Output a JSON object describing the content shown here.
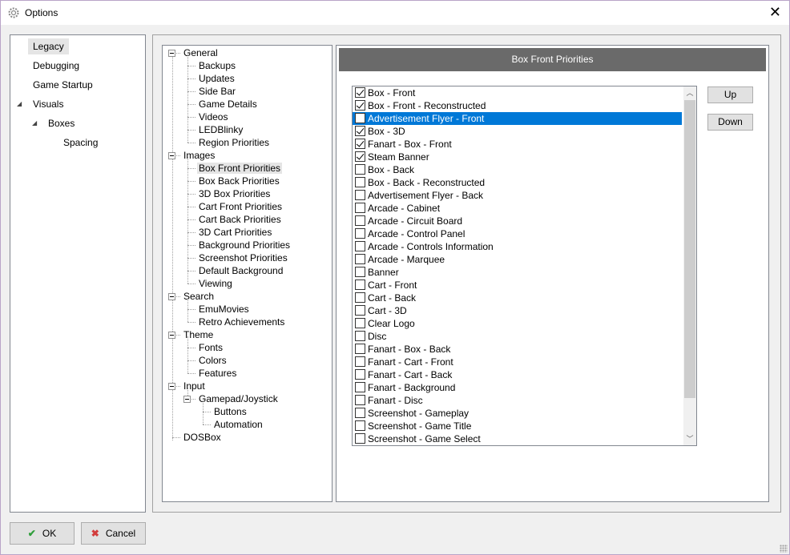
{
  "window": {
    "title": "Options",
    "close_glyph": "✕",
    "icon": "gear-icon"
  },
  "nav": {
    "items": [
      {
        "label": "Legacy",
        "selected": true
      },
      {
        "label": "Debugging"
      },
      {
        "label": "Game Startup"
      },
      {
        "label": "Visuals",
        "expanded": true
      },
      {
        "label": "Boxes",
        "expanded": true
      },
      {
        "label": "Spacing"
      }
    ]
  },
  "tree": {
    "nodes": [
      {
        "label": "General"
      },
      {
        "label": "Backups"
      },
      {
        "label": "Updates"
      },
      {
        "label": "Side Bar"
      },
      {
        "label": "Game Details"
      },
      {
        "label": "Videos"
      },
      {
        "label": "LEDBlinky"
      },
      {
        "label": "Region Priorities"
      },
      {
        "label": "Images"
      },
      {
        "label": "Box Front Priorities",
        "selected": true
      },
      {
        "label": "Box Back Priorities"
      },
      {
        "label": "3D Box Priorities"
      },
      {
        "label": "Cart Front Priorities"
      },
      {
        "label": "Cart Back Priorities"
      },
      {
        "label": "3D Cart Priorities"
      },
      {
        "label": "Background Priorities"
      },
      {
        "label": "Screenshot Priorities"
      },
      {
        "label": "Default Background"
      },
      {
        "label": "Viewing"
      },
      {
        "label": "Search"
      },
      {
        "label": "EmuMovies"
      },
      {
        "label": "Retro Achievements"
      },
      {
        "label": "Theme"
      },
      {
        "label": "Fonts"
      },
      {
        "label": "Colors"
      },
      {
        "label": "Features"
      },
      {
        "label": "Input"
      },
      {
        "label": "Gamepad/Joystick"
      },
      {
        "label": "Buttons"
      },
      {
        "label": "Automation"
      },
      {
        "label": "DOSBox"
      }
    ]
  },
  "content": {
    "header": "Box Front Priorities",
    "items": [
      {
        "label": "Box - Front",
        "checked": true
      },
      {
        "label": "Box - Front - Reconstructed",
        "checked": true
      },
      {
        "label": "Advertisement Flyer - Front",
        "checked": false,
        "selected": true
      },
      {
        "label": "Box - 3D",
        "checked": true
      },
      {
        "label": "Fanart - Box - Front",
        "checked": true
      },
      {
        "label": "Steam Banner",
        "checked": true
      },
      {
        "label": "Box - Back",
        "checked": false
      },
      {
        "label": "Box - Back - Reconstructed",
        "checked": false
      },
      {
        "label": "Advertisement Flyer - Back",
        "checked": false
      },
      {
        "label": "Arcade - Cabinet",
        "checked": false
      },
      {
        "label": "Arcade - Circuit Board",
        "checked": false
      },
      {
        "label": "Arcade - Control Panel",
        "checked": false
      },
      {
        "label": "Arcade - Controls Information",
        "checked": false
      },
      {
        "label": "Arcade - Marquee",
        "checked": false
      },
      {
        "label": "Banner",
        "checked": false
      },
      {
        "label": "Cart - Front",
        "checked": false
      },
      {
        "label": "Cart - Back",
        "checked": false
      },
      {
        "label": "Cart - 3D",
        "checked": false
      },
      {
        "label": "Clear Logo",
        "checked": false
      },
      {
        "label": "Disc",
        "checked": false
      },
      {
        "label": "Fanart - Box - Back",
        "checked": false
      },
      {
        "label": "Fanart - Cart - Front",
        "checked": false
      },
      {
        "label": "Fanart - Cart - Back",
        "checked": false
      },
      {
        "label": "Fanart - Background",
        "checked": false
      },
      {
        "label": "Fanart - Disc",
        "checked": false
      },
      {
        "label": "Screenshot - Gameplay",
        "checked": false
      },
      {
        "label": "Screenshot - Game Title",
        "checked": false
      },
      {
        "label": "Screenshot - Game Select",
        "checked": false
      }
    ],
    "up_label": "Up",
    "down_label": "Down"
  },
  "footer": {
    "ok_label": "OK",
    "cancel_label": "Cancel",
    "ok_icon": "checkmark-icon",
    "cancel_icon": "x-icon"
  },
  "colors": {
    "selection": "#0078d7",
    "header_bg": "#6a6a6a",
    "ok_icon": "#2e9e3a",
    "cancel_icon": "#d23c3c"
  }
}
